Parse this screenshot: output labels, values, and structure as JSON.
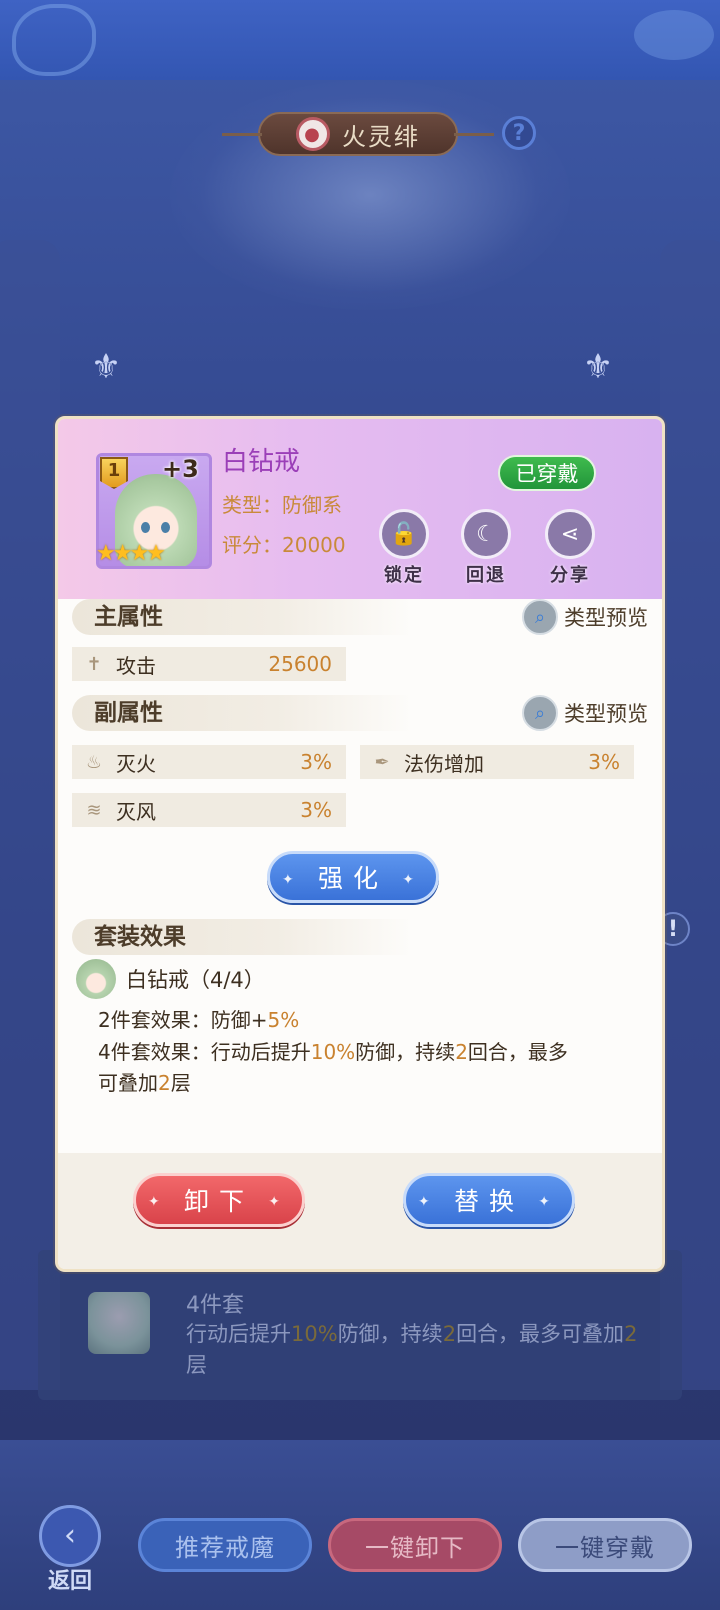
{
  "header": {
    "character_name": "火灵绯",
    "help_icon": "question-icon"
  },
  "card": {
    "item_name": "白钻戒",
    "level_badge": "1",
    "plus_level": "+3",
    "stars": "★★★★",
    "type_text": "类型：防御系",
    "score_text": "评分：20000",
    "equipped_label": "已穿戴",
    "actions": [
      {
        "label": "锁定",
        "icon": "lock-icon"
      },
      {
        "label": "回退",
        "icon": "undo-icon"
      },
      {
        "label": "分享",
        "icon": "share-icon"
      }
    ],
    "main_attr": {
      "title": "主属性",
      "preview_label": "类型预览",
      "stats": [
        {
          "name": "攻击",
          "value": "25600",
          "icon": "sword-icon"
        }
      ]
    },
    "sub_attr": {
      "title": "副属性",
      "preview_label": "类型预览",
      "stats": [
        {
          "name": "灭火",
          "value": "3%",
          "icon": "fire-pot-icon"
        },
        {
          "name": "法伤增加",
          "value": "3%",
          "icon": "feather-icon"
        },
        {
          "name": "灭风",
          "value": "3%",
          "icon": "wind-icon"
        }
      ]
    },
    "enhance_label": "强化",
    "set_effect": {
      "title": "套装效果",
      "set_name": "白钻戒（4/4）",
      "two_piece_prefix": "2件套效果：防御+",
      "two_piece_value": "5%",
      "four_piece_prefix": "4件套效果：行动后提升",
      "four_piece_value": "10%",
      "four_piece_mid": "防御，持续",
      "four_piece_turns": "2",
      "four_piece_mid2": "回合，最多",
      "four_piece_line2_prefix": "可叠加",
      "four_piece_layers": "2",
      "four_piece_suffix": "层"
    },
    "unequip_label": "卸下",
    "replace_label": "替换"
  },
  "background_set": {
    "title": "4件套",
    "desc_prefix": "行动后提升",
    "desc_value": "10%",
    "desc_mid": "防御，持续",
    "desc_turns": "2",
    "desc_mid2": "回合，最多可叠加",
    "desc_layers": "2",
    "desc_suffix": "层"
  },
  "bottom_bar": {
    "back_label": "返回",
    "recommend_label": "推荐戒魔",
    "unequip_all_label": "一键卸下",
    "equip_all_label": "一键穿戴"
  }
}
